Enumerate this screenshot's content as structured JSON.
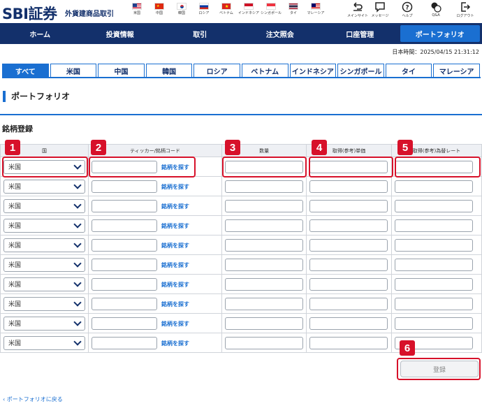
{
  "header": {
    "logo": "SBI証券",
    "subtitle": "外貨建商品取引",
    "flags": [
      {
        "label": "米国",
        "icon": "us-flag-icon"
      },
      {
        "label": "中国",
        "icon": "china-flag-icon"
      },
      {
        "label": "韓国",
        "icon": "korea-flag-icon"
      },
      {
        "label": "ロシア",
        "icon": "russia-flag-icon"
      },
      {
        "label": "ベトナム",
        "icon": "vietnam-flag-icon"
      },
      {
        "label": "インドネシア",
        "icon": "indonesia-flag-icon"
      },
      {
        "label": "シンガポール",
        "icon": "singapore-flag-icon"
      },
      {
        "label": "タイ",
        "icon": "thailand-flag-icon"
      },
      {
        "label": "マレーシア",
        "icon": "malaysia-flag-icon"
      }
    ],
    "utilities": [
      {
        "label": "メインサイト",
        "icon": "back-arrow-icon"
      },
      {
        "label": "メッセージ",
        "icon": "message-icon"
      },
      {
        "label": "ヘルプ",
        "icon": "help-icon"
      },
      {
        "label": "Q&A",
        "icon": "qa-icon"
      },
      {
        "label": "ログアウト",
        "icon": "logout-icon"
      }
    ]
  },
  "nav": {
    "items": [
      "ホーム",
      "投資情報",
      "取引",
      "注文照会",
      "口座管理",
      "ポートフォリオ"
    ],
    "active": "ポートフォリオ"
  },
  "timestamp": "日本時間：2025/04/15 21:31:12",
  "tabs": {
    "items": [
      "すべて",
      "米国",
      "中国",
      "韓国",
      "ロシア",
      "ベトナム",
      "インドネシア",
      "シンガポール",
      "タイ",
      "マレーシア"
    ],
    "active": "すべて"
  },
  "page_title": "ポートフォリオ",
  "form": {
    "title": "銘柄登録",
    "columns": {
      "country": "国",
      "ticker": "ティッカー/銘柄コード",
      "quantity": "数量",
      "unit_price": "取得(参考)単価",
      "fx_rate": "取得(参考)為替レート"
    },
    "row_count": 10,
    "default_country": "米国",
    "find_link": "銘柄を探す"
  },
  "callouts": [
    "1",
    "2",
    "3",
    "4",
    "5",
    "6"
  ],
  "register_button": "登録",
  "back_link": "ポートフォリオに戻る",
  "colors": {
    "navy": "#13306b",
    "accent": "#1a6fd1",
    "callout": "#d7112a"
  }
}
